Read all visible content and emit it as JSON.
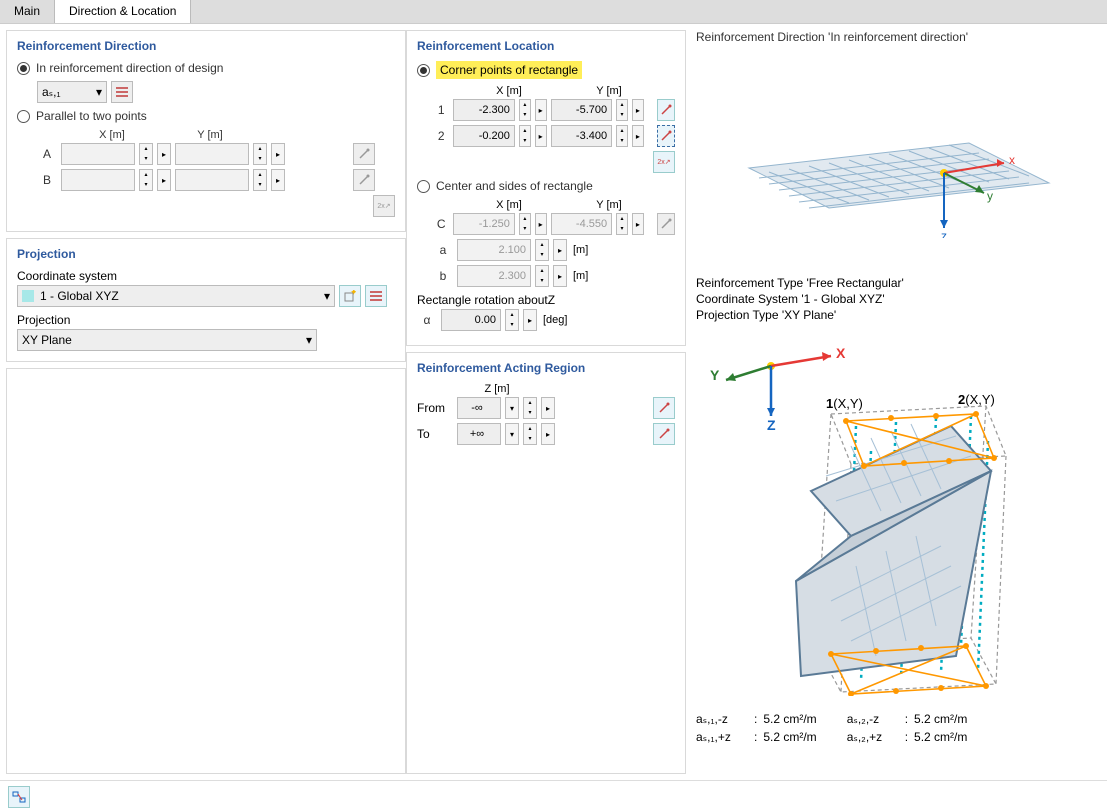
{
  "tabs": {
    "main": "Main",
    "dl": "Direction & Location"
  },
  "left": {
    "dir_title": "Reinforcement Direction",
    "opt_in": "In reinforcement direction of design",
    "as1": "aₛ,₁",
    "opt_par": "Parallel to two points",
    "xh": "X [m]",
    "yh": "Y [m]",
    "A": "A",
    "B": "B",
    "proj_title": "Projection",
    "coord_lbl": "Coordinate system",
    "coord_val": "1 - Global XYZ",
    "proj_lbl": "Projection",
    "proj_val": "XY Plane"
  },
  "mid": {
    "loc_title": "Reinforcement Location",
    "opt_corner": "Corner points of rectangle",
    "xh2": "X [m]",
    "yh2": "Y [m]",
    "r1": "1",
    "r1x": "-2.300",
    "r1y": "-5.700",
    "r2": "2",
    "r2x": "-0.200",
    "r2y": "-3.400",
    "opt_center": "Center and sides of rectangle",
    "C": "C",
    "Cx": "-1.250",
    "Cy": "-4.550",
    "a": "a",
    "av": "2.100",
    "b": "b",
    "bv": "2.300",
    "um": "[m]",
    "rot_lbl": "Rectangle rotation aboutZ",
    "alpha": "α",
    "alpha_v": "0.00",
    "udeg": "[deg]",
    "act_title": "Reinforcement Acting Region",
    "zh": "Z [m]",
    "from": "From",
    "from_v": "-∞",
    "to": "To",
    "to_v": "+∞"
  },
  "right": {
    "pre1_title": "Reinforcement Direction 'In reinforcement direction'",
    "info1": "Reinforcement Type 'Free Rectangular'",
    "info2": "Coordinate System '1 - Global XYZ'",
    "info3": "Projection Type 'XY Plane'",
    "axisX": "X",
    "axisY": "Y",
    "axisZ": "Z",
    "axisx": "x",
    "axisy": "y",
    "axisz": "z",
    "p1": "1(X,Y)",
    "p2": "2(X,Y)",
    "as11": "aₛ,₁,-z",
    "v11": "5.2 cm²/m",
    "as12": "aₛ,₁,+z",
    "v12": "5.2 cm²/m",
    "as21": "aₛ,₂,-z",
    "v21": "5.2 cm²/m",
    "as22": "aₛ,₂,+z",
    "v22": "5.2 cm²/m"
  }
}
